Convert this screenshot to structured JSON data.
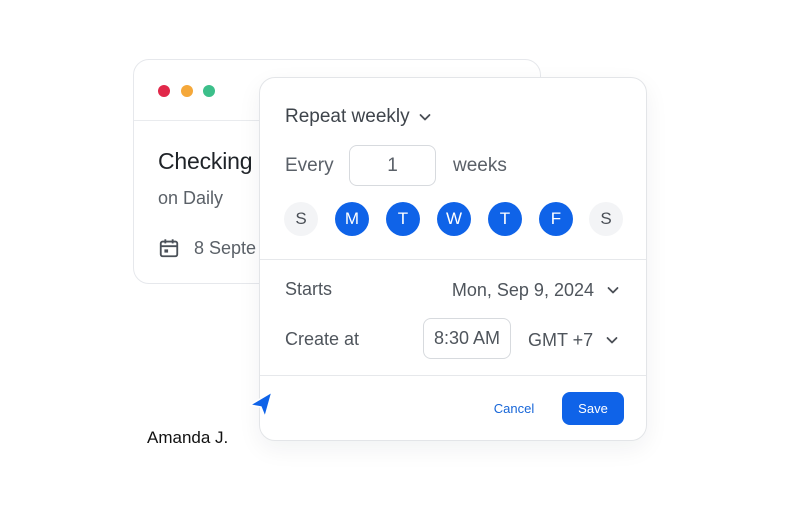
{
  "back_card": {
    "title": "Checking",
    "subtitle": "on Daily",
    "date_text": "8 Septe",
    "icons": {
      "date": "calendar-icon"
    }
  },
  "popover": {
    "repeat_label": "Repeat weekly",
    "every_label": "Every",
    "every_value": "1",
    "weeks_label": "weeks",
    "days": [
      {
        "label": "S",
        "selected": false
      },
      {
        "label": "M",
        "selected": true
      },
      {
        "label": "T",
        "selected": true
      },
      {
        "label": "W",
        "selected": true
      },
      {
        "label": "T",
        "selected": true
      },
      {
        "label": "F",
        "selected": true
      },
      {
        "label": "S",
        "selected": false
      }
    ],
    "starts_label": "Starts",
    "starts_value": "Mon, Sep 9, 2024",
    "create_label": "Create at",
    "time_value": "8:30 AM",
    "timezone_value": "GMT +7",
    "cancel_label": "Cancel",
    "save_label": "Save"
  },
  "cursor_user": "Amanda J.",
  "colors": {
    "accent": "#0f63e8",
    "window_red": "#e1284a",
    "window_yellow": "#f5a83a",
    "window_green": "#3cbf8a"
  }
}
